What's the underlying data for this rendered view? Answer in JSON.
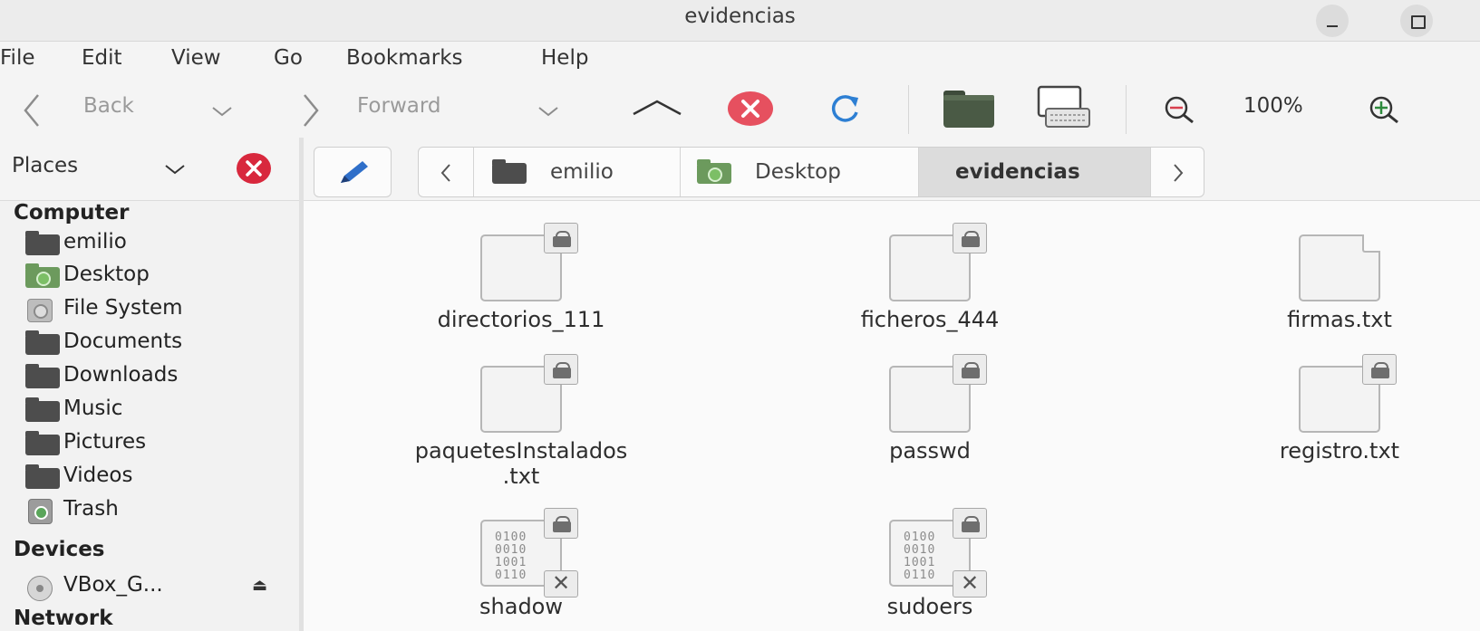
{
  "window": {
    "title": "evidencias"
  },
  "menu": [
    "File",
    "Edit",
    "View",
    "Go",
    "Bookmarks",
    "Help"
  ],
  "toolbar": {
    "back_label": "Back",
    "forward_label": "Forward",
    "zoom_level": "100%"
  },
  "places": {
    "label": "Places"
  },
  "breadcrumb": [
    {
      "label": "emilio",
      "icon": "home-folder-icon"
    },
    {
      "label": "Desktop",
      "icon": "desktop-folder-icon"
    },
    {
      "label": "evidencias",
      "active": true
    }
  ],
  "sidebar": {
    "computer_label": "Computer",
    "computer_items": [
      {
        "label": "emilio",
        "icon": "folder-icon"
      },
      {
        "label": "Desktop",
        "icon": "desktop-folder-icon"
      },
      {
        "label": "File System",
        "icon": "drive-icon"
      },
      {
        "label": "Documents",
        "icon": "folder-icon"
      },
      {
        "label": "Downloads",
        "icon": "folder-icon"
      },
      {
        "label": "Music",
        "icon": "folder-icon"
      },
      {
        "label": "Pictures",
        "icon": "folder-icon"
      },
      {
        "label": "Videos",
        "icon": "folder-icon"
      },
      {
        "label": "Trash",
        "icon": "trash-icon"
      }
    ],
    "devices_label": "Devices",
    "device_items": [
      {
        "label": "VBox_G...",
        "icon": "optical-disc-icon"
      }
    ],
    "network_label": "Network"
  },
  "files": [
    {
      "name": "directorios_111",
      "type": "text",
      "locked": true
    },
    {
      "name": "ficheros_444",
      "type": "text",
      "locked": true
    },
    {
      "name": "firmas.txt",
      "type": "text",
      "locked": false
    },
    {
      "name": "paquetesInstalados.txt",
      "name_line1": "paquetesInstalados",
      "name_line2": ".txt",
      "type": "text",
      "locked": true
    },
    {
      "name": "passwd",
      "type": "text",
      "locked": true
    },
    {
      "name": "registro.txt",
      "type": "text",
      "locked": true
    },
    {
      "name": "shadow",
      "type": "binary",
      "locked": true,
      "unreadable": true
    },
    {
      "name": "sudoers",
      "type": "binary",
      "locked": true,
      "unreadable": true
    }
  ],
  "binary_glyph": [
    "0100",
    "0010",
    "1001",
    "0110"
  ]
}
